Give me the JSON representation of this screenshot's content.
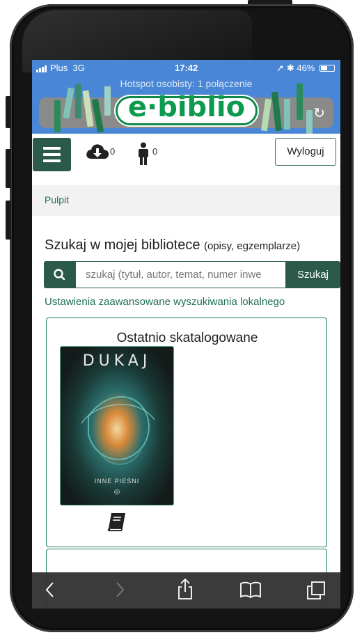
{
  "status_bar": {
    "carrier": "Plus",
    "network": "3G",
    "time": "17:42",
    "battery": "46%"
  },
  "hotspot_banner": "Hotspot osobisty: 1 połączenie",
  "logo": {
    "text": "e·biblio"
  },
  "nav": {
    "downloads_count": "0",
    "users_count": "0",
    "logout_label": "Wyloguj"
  },
  "breadcrumb": {
    "label": "Pulpit"
  },
  "search": {
    "title": "Szukaj w mojej bibliotece",
    "subtitle": "(opisy, egzemplarze)",
    "placeholder": "szukaj (tytuł, autor, temat, numer inwe",
    "button_label": "Szukaj",
    "advanced_link": "Ustawienia zaawansowane wyszukiwania lokalnego"
  },
  "recent": {
    "title": "Ostatnio skatalogowane",
    "book": {
      "author": "DUKAJ",
      "title": "INNE PIEŚNI"
    }
  },
  "colors": {
    "primary": "#2b5a4b",
    "link": "#1f6f55",
    "safari_blue": "#4a86d6",
    "logo_green": "#0c9a4e"
  },
  "icons": [
    "signal-icon",
    "location-icon",
    "bluetooth-icon",
    "battery-icon",
    "reload-icon",
    "menu-icon",
    "cloud-download-icon",
    "user-icon",
    "search-icon",
    "book-icon",
    "back-icon",
    "forward-icon",
    "share-icon",
    "bookmarks-icon",
    "tabs-icon"
  ]
}
